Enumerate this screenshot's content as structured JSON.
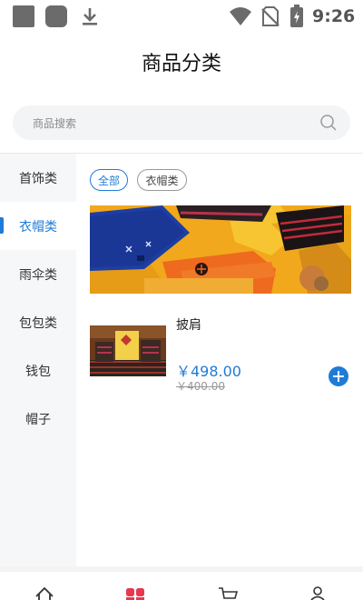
{
  "status_bar": {
    "time": "9:26",
    "icons": [
      "app-icon",
      "app-icon",
      "download-icon",
      "wifi-icon",
      "no-sim-icon",
      "battery-charging-icon"
    ]
  },
  "header": {
    "title": "商品分类"
  },
  "search": {
    "placeholder": "商品搜索",
    "icon": "search-icon"
  },
  "sidebar": {
    "items": [
      {
        "label": "首饰类",
        "active": false
      },
      {
        "label": "衣帽类",
        "active": true
      },
      {
        "label": "雨伞类",
        "active": false
      },
      {
        "label": "包包类",
        "active": false
      },
      {
        "label": "钱包",
        "active": false
      },
      {
        "label": "帽子",
        "active": false
      }
    ]
  },
  "filters": {
    "chips": [
      {
        "label": "全部",
        "selected": true
      },
      {
        "label": "衣帽类",
        "selected": false
      }
    ]
  },
  "products": [
    {
      "name": "披肩",
      "price": "￥498.00",
      "old_price": "￥400.00"
    }
  ],
  "bottom_nav": {
    "items": [
      {
        "icon": "home-icon",
        "active": false
      },
      {
        "icon": "category-icon",
        "active": true
      },
      {
        "icon": "cart-icon",
        "active": false
      },
      {
        "icon": "profile-icon",
        "active": false
      }
    ]
  },
  "colors": {
    "accent": "#1f7bd6",
    "sidebar_bg": "#f6f7f8",
    "category_active": "#e8374e"
  }
}
